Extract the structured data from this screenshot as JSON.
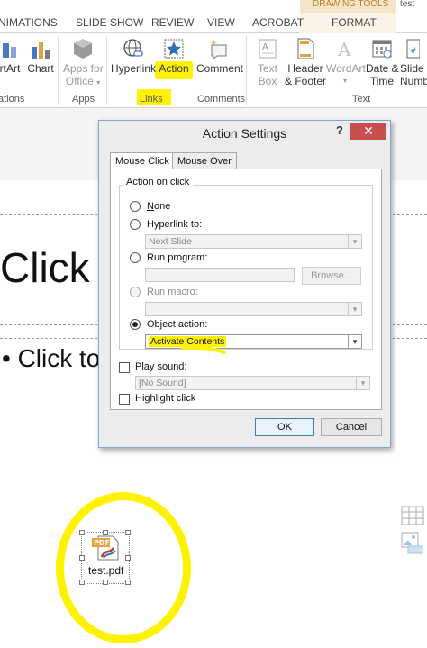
{
  "ribbon": {
    "tabs": [
      "ANIMATIONS",
      "SLIDE SHOW",
      "REVIEW",
      "VIEW",
      "ACROBAT",
      "FORMAT"
    ],
    "tabs_visible": [
      "NIMATIONS",
      "SLIDE SHOW",
      "REVIEW",
      "VIEW",
      "ACROBAT",
      "FORMAT"
    ],
    "contextual_title": "DRAWING TOOLS",
    "right_tab": "test",
    "buttons": {
      "smartart": "rtArt",
      "chart": "Chart",
      "apps_line1": "Apps for",
      "apps_line2": "Office",
      "hyperlink": "Hyperlink",
      "action": "Action",
      "comment": "Comment",
      "textbox_line1": "Text",
      "textbox_line2": "Box",
      "header_line1": "Header",
      "header_line2": "& Footer",
      "wordart": "WordArt",
      "datetime_line1": "Date &",
      "datetime_line2": "Time",
      "slide_line1": "Slide",
      "slide_line2": "Numb"
    },
    "groups": {
      "illustrations": "ations",
      "apps": "Apps",
      "links": "Links",
      "comments": "Comments",
      "text": "Text"
    }
  },
  "slide": {
    "title_text": "Click t",
    "bullet_text": "• Click to"
  },
  "dialog": {
    "title": "Action Settings",
    "help": "?",
    "close": "✕",
    "tabs": [
      "Mouse Click",
      "Mouse Over"
    ],
    "group_label": "Action on click",
    "options": {
      "none": "None",
      "hyperlink": "Hyperlink to:",
      "hyperlink_value": "Next Slide",
      "run_program": "Run program:",
      "browse": "Browse...",
      "run_macro": "Run macro:",
      "object_action": "Object action:",
      "object_action_value": "Activate Contents"
    },
    "play_sound": "Play sound:",
    "sound_value": "[No Sound]",
    "highlight_click": "Highlight click",
    "ok": "OK",
    "cancel": "Cancel"
  },
  "object": {
    "file_label": "test.pdf",
    "icon_text": "PDF"
  },
  "colors": {
    "highlight": "#fff200",
    "close_button": "#c7504f",
    "contextual_tab": "#c0792a"
  }
}
